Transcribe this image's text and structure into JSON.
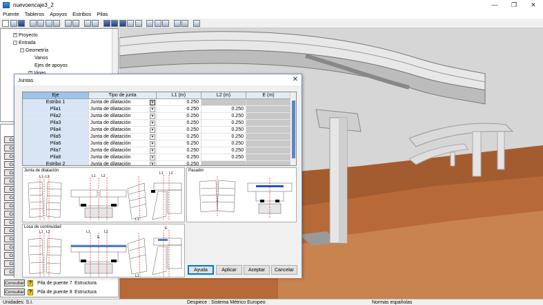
{
  "window": {
    "title": "nuevoencaje3_2",
    "minimize_icon": "minimize-icon",
    "maximize_icon": "maximize-icon",
    "close_icon": "close-icon"
  },
  "menu": [
    "Puente",
    "Tableros",
    "Apoyos",
    "Estribos",
    "Pilas"
  ],
  "tree": {
    "items": [
      {
        "label": "Proyecto",
        "expander": "+"
      },
      {
        "label": "Entrada",
        "expander": "−"
      },
      {
        "label": "Geometría",
        "expander": "−"
      },
      {
        "label": "Vanos",
        "expander": ""
      },
      {
        "label": "Ejes de apoyos",
        "expander": ""
      },
      {
        "label": "Vigas",
        "expander": "+"
      }
    ]
  },
  "side_list": {
    "button_label": "Consultar",
    "button_label_short": "Cons",
    "rows": [
      {
        "label": "Pila de puente 7",
        "type": "Estructura"
      },
      {
        "label": "Pila de puente 8",
        "type": "Estructura"
      }
    ]
  },
  "statusbar": {
    "units": "Unidades: S.I.",
    "despiece": "Despiece : Sistema Métrico Europeo",
    "normas": "Normas españolas"
  },
  "dialog": {
    "title": "Juntas",
    "columns": [
      "Eje",
      "Tipo de junta",
      "L1 (m)",
      "L2 (m)",
      "E (m)"
    ],
    "rows": [
      {
        "eje": "Estribo 1",
        "tipo": "Junta de dilatación",
        "l1": "0.250",
        "l2": "",
        "e": ""
      },
      {
        "eje": "Pila1",
        "tipo": "Junta de dilatación",
        "l1": "0.250",
        "l2": "0.250",
        "e": ""
      },
      {
        "eje": "Pila2",
        "tipo": "Junta de dilatación",
        "l1": "0.250",
        "l2": "0.250",
        "e": ""
      },
      {
        "eje": "Pila3",
        "tipo": "Junta de dilatación",
        "l1": "0.250",
        "l2": "0.250",
        "e": ""
      },
      {
        "eje": "Pila4",
        "tipo": "Junta de dilatación",
        "l1": "0.250",
        "l2": "0.250",
        "e": ""
      },
      {
        "eje": "Pila5",
        "tipo": "Junta de dilatación",
        "l1": "0.250",
        "l2": "0.250",
        "e": ""
      },
      {
        "eje": "Pila6",
        "tipo": "Junta de dilatación",
        "l1": "0.250",
        "l2": "0.250",
        "e": ""
      },
      {
        "eje": "Pila7",
        "tipo": "Junta de dilatación",
        "l1": "0.250",
        "l2": "0.250",
        "e": ""
      },
      {
        "eje": "Pila8",
        "tipo": "Junta de dilatación",
        "l1": "0.250",
        "l2": "0.250",
        "e": ""
      },
      {
        "eje": "Estribo 2",
        "tipo": "Junta de dilatación",
        "l1": "0.250",
        "l2": "",
        "e": ""
      }
    ],
    "diagrams": {
      "junta": "Junta de dilatación",
      "pasador": "Pasador",
      "losa": "Losa de continuidad"
    },
    "dim_labels": {
      "l1": "L1",
      "l2": "L2",
      "e": "E"
    },
    "buttons": {
      "ayuda": "Ayuda",
      "aplicar": "Aplicar",
      "aceptar": "Aceptar",
      "cancelar": "Cancelar"
    }
  },
  "colors": {
    "sky": "#d6d6d6",
    "terrain": "#a35c30",
    "terrain_light": "#c9834f",
    "deck": "#d9d9d9",
    "accent": "#0078d7",
    "dim_red": "#d40000"
  }
}
